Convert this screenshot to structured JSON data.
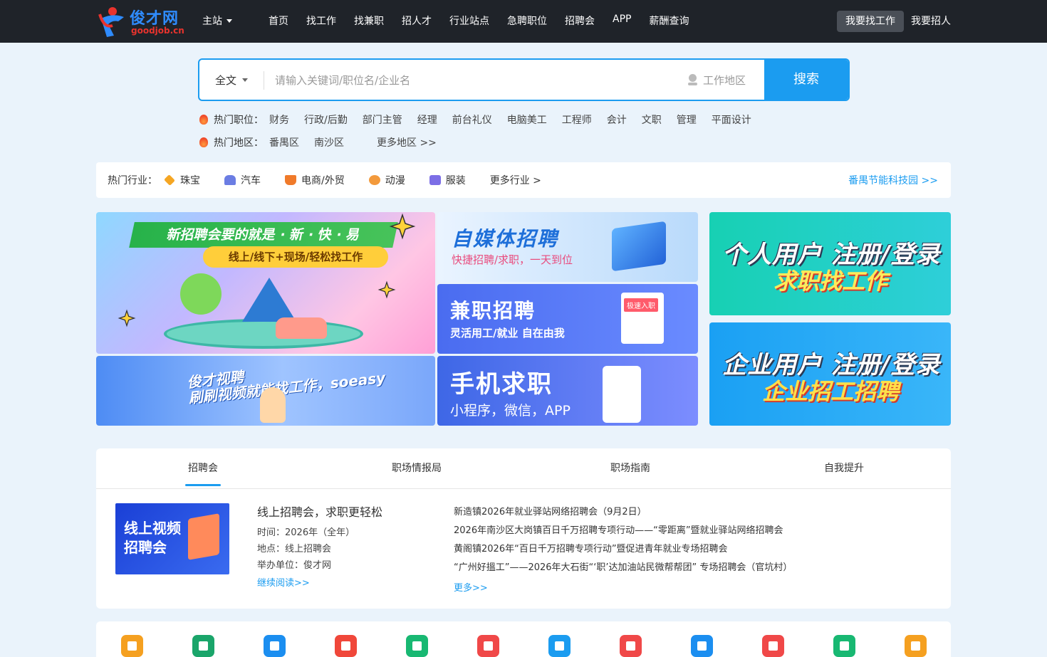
{
  "brand": {
    "name": "俊才网",
    "sub": "goodjob.cn"
  },
  "station": "主站",
  "nav": [
    "首页",
    "找工作",
    "找兼职",
    "招人才",
    "行业站点",
    "急聘职位",
    "招聘会",
    "APP",
    "薪酬查询"
  ],
  "actions": {
    "find_job": "我要找工作",
    "hire": "我要招人"
  },
  "search": {
    "category": "全文",
    "placeholder": "请输入关键词/职位名/企业名",
    "location": "工作地区",
    "button": "搜索"
  },
  "hot_jobs": {
    "label": "热门职位：",
    "items": [
      "财务",
      "行政/后勤",
      "部门主管",
      "经理",
      "前台礼仪",
      "电脑美工",
      "工程师",
      "会计",
      "文职",
      "管理",
      "平面设计"
    ]
  },
  "hot_areas": {
    "label": "热门地区：",
    "items": [
      "番禺区",
      "南沙区"
    ],
    "more": "更多地区 >>"
  },
  "industry": {
    "label": "热门行业：",
    "items": [
      {
        "name": "珠宝",
        "icon": "diamond-icon",
        "color": "#f5a623"
      },
      {
        "name": "汽车",
        "icon": "car-icon",
        "color": "#6b7de3"
      },
      {
        "name": "电商/外贸",
        "icon": "cart-icon",
        "color": "#f07a2a"
      },
      {
        "name": "动漫",
        "icon": "anime-icon",
        "color": "#f39a3c"
      },
      {
        "name": "服装",
        "icon": "shirt-icon",
        "color": "#7c6ee6"
      }
    ],
    "more": "更多行业 >",
    "park": "番禺节能科技园 >>"
  },
  "banners": {
    "fair": {
      "title": "新招聘会要的就是 · 新 · 快 · 易",
      "sub": "线上/线下+现场/轻松找工作"
    },
    "media": {
      "title": "自媒体招聘",
      "sub": "快捷招聘/求职，一天到位"
    },
    "parttime": {
      "title": "兼职招聘",
      "sub": "灵活用工/就业 自在由我",
      "tag": "极速入职"
    },
    "video": {
      "title": "俊才视聘",
      "sub": "刷刷视频就能找工作，soeasy"
    },
    "mobile": {
      "title": "手机求职",
      "sub": "小程序，微信，APP"
    },
    "personal": {
      "title": "个人用户 注册/登录",
      "sub": "求职找工作"
    },
    "company": {
      "title": "企业用户 注册/登录",
      "sub": "企业招工招聘"
    }
  },
  "tabs": [
    "招聘会",
    "职场情报局",
    "职场指南",
    "自我提升"
  ],
  "fair": {
    "img_text": "线上视频招聘会",
    "title": "线上招聘会，求职更轻松",
    "time": "时间：2026年（全年）",
    "place": "地点：线上招聘会",
    "organizer": "举办单位：俊才网",
    "more": "继续阅读>>"
  },
  "news": [
    "新造镇2026年就业驿站网络招聘会（9月2日）",
    "2026年南沙区大岗镇百日千万招聘专项行动——“零距离”暨就业驿站网络招聘会",
    "黄阁镇2026年“百日千万招聘专项行动”暨促进青年就业专场招聘会",
    "“广州好搵工”——2026年大石街“‘职’达加油站民微帮帮团” 专场招聘会（官坑村）"
  ],
  "news_more": "更多>>",
  "bottom_icons": [
    {
      "name": "food-icon",
      "color": "#f5a020"
    },
    {
      "name": "umbrella-icon",
      "color": "#1aa56a"
    },
    {
      "name": "house-icon",
      "color": "#1b8ef0"
    },
    {
      "name": "chart-icon",
      "color": "#f0473a"
    },
    {
      "name": "table-icon",
      "color": "#18b872"
    },
    {
      "name": "wallet-icon",
      "color": "#f04848"
    },
    {
      "name": "beach-icon",
      "color": "#1b9cf0"
    },
    {
      "name": "cup-icon",
      "color": "#f04848"
    },
    {
      "name": "bus-icon",
      "color": "#1b8ef0"
    },
    {
      "name": "trophy-icon",
      "color": "#f04848"
    },
    {
      "name": "monitor-icon",
      "color": "#18b872"
    },
    {
      "name": "building-icon",
      "color": "#f5a020"
    }
  ]
}
